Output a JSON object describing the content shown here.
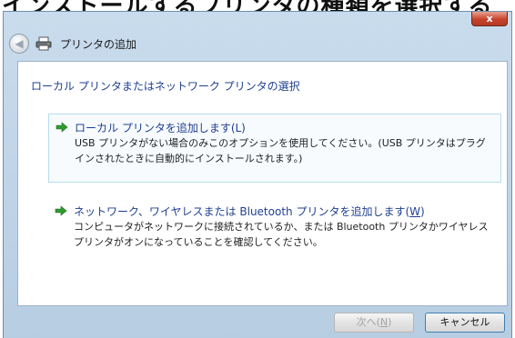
{
  "top_caption": "インストールするプリンタの種類を選択する",
  "window": {
    "title": "プリンタの追加",
    "close_label": "x"
  },
  "content": {
    "heading": "ローカル プリンタまたはネットワーク プリンタの選択",
    "options": [
      {
        "title_pre": "ローカル プリンタを追加します(L)",
        "title_key": "",
        "title_post": "",
        "description": "USB プリンタがない場合のみこのオプションを使用してください。(USB プリンタはプラグ インされたときに自動的にインストールされます。)"
      },
      {
        "title_pre": "ネットワーク、ワイヤレスまたは Bluetooth プリンタを追加します(",
        "title_key": "W",
        "title_post": ")",
        "description": "コンピュータがネットワークに接続されているか、または Bluetooth プリンタかワイヤレス プリンタがオンになっていることを確認してください。"
      }
    ]
  },
  "buttons": {
    "next_pre": "次へ(",
    "next_key": "N",
    "next_post": ")",
    "cancel": "キャンセル"
  },
  "colors": {
    "link_blue": "#1f3f8f",
    "arrow_green": "#2e9b2e",
    "frame_blue": "#c9dced"
  },
  "icons": [
    "back-arrow-icon",
    "printer-icon",
    "green-arrow-icon"
  ]
}
